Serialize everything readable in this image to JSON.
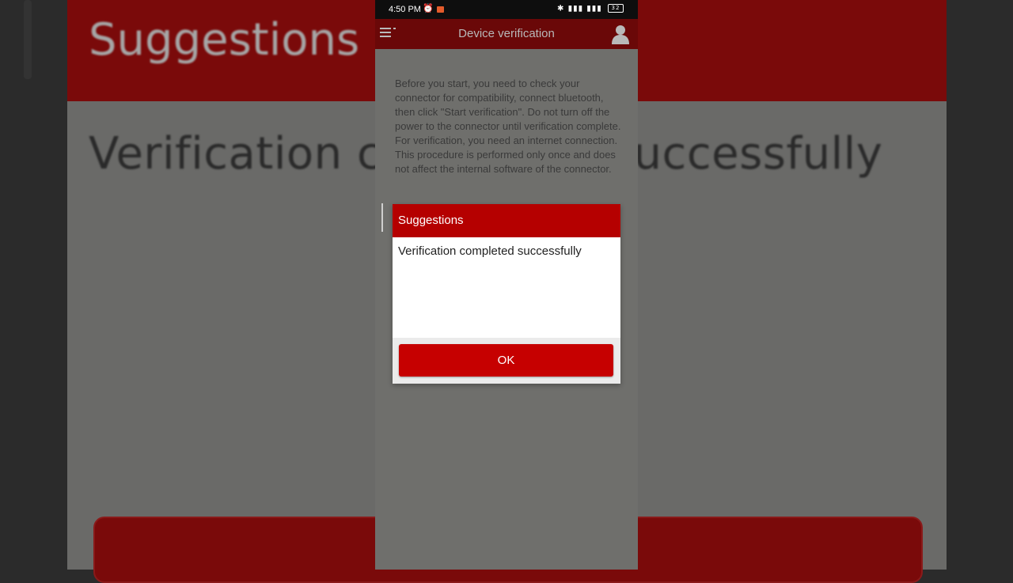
{
  "status_bar": {
    "time": "4:50 PM",
    "battery": "32"
  },
  "app_bar": {
    "title": "Device verification"
  },
  "main": {
    "instructions": "Before you start, you need to check your connector for compatibility, connect bluetooth, then click \"Start verification\". Do not turn off the power to the connector until verification complete. For verification, you need an internet connection. This procedure is performed only once and does not affect the internal software of the connector."
  },
  "dialog": {
    "title": "Suggestions",
    "message": "Verification completed successfully",
    "ok_label": "OK"
  },
  "background_zoom": {
    "title": "Suggestions",
    "message": "Verification completed successfully"
  },
  "colors": {
    "accent": "#c60000",
    "header": "#b50000",
    "app_bar": "#6a0808"
  },
  "icons": {
    "menu": "menu-icon",
    "user": "user-icon",
    "alarm": "alarm-icon",
    "bluetooth": "bluetooth-icon"
  }
}
